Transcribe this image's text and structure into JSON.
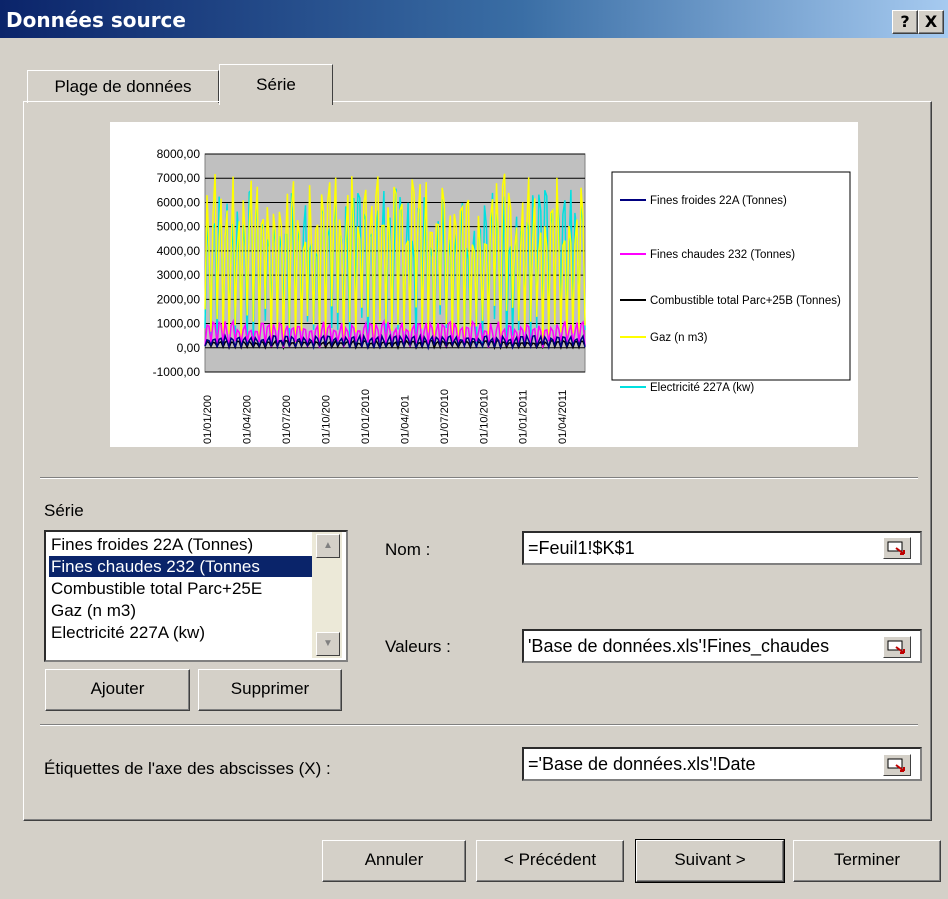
{
  "window": {
    "title": "Données source",
    "help_button": "?",
    "close_button": "X"
  },
  "tabs": [
    {
      "label": "Plage de données",
      "active": false
    },
    {
      "label": "Série",
      "active": true
    }
  ],
  "chart_data": {
    "type": "line",
    "title": "",
    "x_tick_labels": [
      "01/01/200",
      "01/04/200",
      "01/07/200",
      "01/10/200",
      "01/01/2010",
      "01/04/201",
      "01/07/2010",
      "01/10/2010",
      "01/01/2011",
      "01/04/2011"
    ],
    "y_tick_labels": [
      "8000,00",
      "7000,00",
      "6000,00",
      "5000,00",
      "4000,00",
      "3000,00",
      "2000,00",
      "1000,00",
      "0,00",
      "-1000,00"
    ],
    "ylim": [
      -1000,
      8000
    ],
    "grid": true,
    "legend_placement": "right",
    "series": [
      {
        "name": "Fines froides 22A (Tonnes)",
        "color": "#000080",
        "approx_range": [
          0,
          500
        ]
      },
      {
        "name": "Fines chaudes 232 (Tonnes)",
        "color": "#ff00ff",
        "approx_range": [
          0,
          1100
        ]
      },
      {
        "name": "Combustible total Parc+25B (Tonnes)",
        "color": "#000000",
        "approx_range": [
          0,
          300
        ]
      },
      {
        "name": "Gaz (n m3)",
        "color": "#ffff00",
        "approx_range": [
          0,
          7200
        ]
      },
      {
        "name": "Electricité 227A (kw)",
        "color": "#00e0e0",
        "approx_range": [
          0,
          6600
        ]
      }
    ]
  },
  "serie_section": {
    "label": "Série",
    "items": [
      "Fines froides 22A (Tonnes)",
      "Fines chaudes 232 (Tonnes",
      "Combustible total Parc+25E",
      "Gaz (n m3)",
      "Electricité 227A (kw)"
    ],
    "selected_index": 1,
    "add_button": "Ajouter",
    "remove_button": "Supprimer"
  },
  "fields": {
    "nom_label": "Nom :",
    "nom_value": "=Feuil1!$K$1",
    "valeurs_label": "Valeurs :",
    "valeurs_value": "'Base de données.xls'!Fines_chaudes",
    "x_labels_label": "Étiquettes de l'axe des abscisses (X) :",
    "x_labels_value": "='Base de données.xls'!Date"
  },
  "footer": {
    "cancel": "Annuler",
    "previous": "< Précédent",
    "next": "Suivant >",
    "finish": "Terminer"
  }
}
